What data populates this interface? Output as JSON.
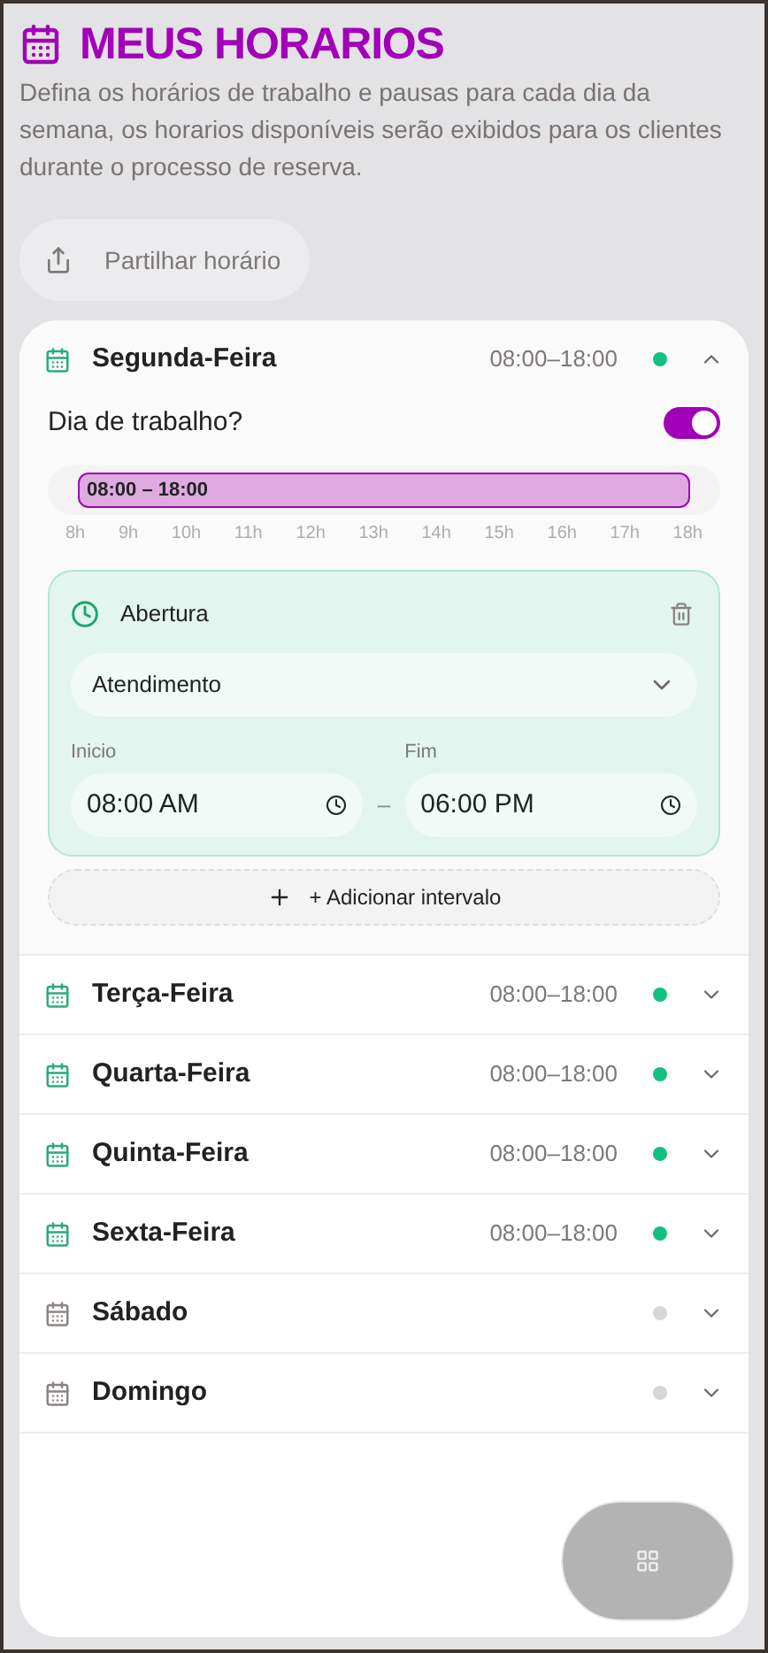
{
  "header": {
    "title": "MEUS HORARIOS",
    "description": "Defina os horários de trabalho e pausas para cada dia da semana, os horarios disponíveis serão exibidos para os clientes durante o processo de reserva."
  },
  "share_button": {
    "label": "Partilhar horário"
  },
  "days": [
    {
      "name": "Segunda-Feira",
      "hours": "08:00–18:00",
      "working": true,
      "expanded": true
    },
    {
      "name": "Terça-Feira",
      "hours": "08:00–18:00",
      "working": true,
      "expanded": false
    },
    {
      "name": "Quarta-Feira",
      "hours": "08:00–18:00",
      "working": true,
      "expanded": false
    },
    {
      "name": "Quinta-Feira",
      "hours": "08:00–18:00",
      "working": true,
      "expanded": false
    },
    {
      "name": "Sexta-Feira",
      "hours": "08:00–18:00",
      "working": true,
      "expanded": false
    },
    {
      "name": "Sábado",
      "working": false,
      "expanded": false
    },
    {
      "name": "Domingo",
      "working": false,
      "expanded": false
    }
  ],
  "day_detail": {
    "workday_label": "Dia de trabalho?",
    "workday_on": true,
    "timeline": {
      "bar_label": "08:00 – 18:00",
      "ticks": [
        "8h",
        "9h",
        "10h",
        "11h",
        "12h",
        "13h",
        "14h",
        "15h",
        "16h",
        "17h",
        "18h"
      ]
    },
    "intervals": [
      {
        "title": "Abertura",
        "type": "Atendimento",
        "start_label": "Inicio",
        "start": "08:00 AM",
        "separator": "–",
        "end_label": "Fim",
        "end": "06:00 PM"
      }
    ],
    "add_button": "+ Adicionar intervalo"
  }
}
